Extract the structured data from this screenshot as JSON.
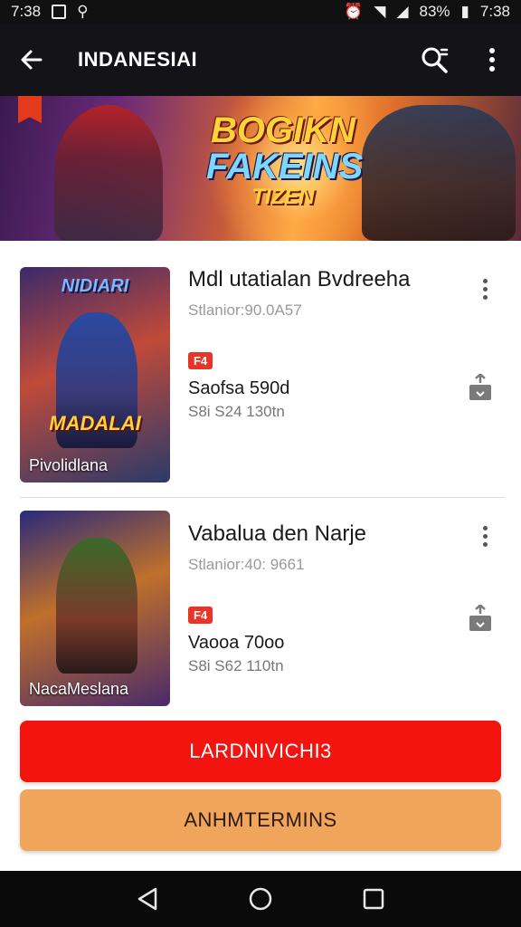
{
  "status_bar": {
    "time_left": "7:38",
    "battery": "83%",
    "time_right": "7:38"
  },
  "app_bar": {
    "title": "INDANESIAI"
  },
  "banner": {
    "logo_line1": "BOGIKN",
    "logo_line2": "FAKEINS",
    "logo_line3": "TIZEN"
  },
  "items": [
    {
      "title": "Mdl utatialan Bvdreeha",
      "subtitle": "Stlanior:90.0A57",
      "badge": "F4",
      "price": "Saofsa  590d",
      "size": "S8i S24  130tn",
      "thumb_logo": "NIDIARI",
      "thumb_logo2": "MADALAI",
      "thumb_caption": "Pivolidlana"
    },
    {
      "title": "Vabalua den Narje",
      "subtitle": "Stlanior:40: 9661",
      "badge": "F4",
      "price": "Vaooa  70oo",
      "size": "S8i S62  110tn",
      "thumb_caption": "NacaMeslana"
    }
  ],
  "buttons": {
    "primary": "LARDNIVICHI3",
    "secondary": "ANHMTERMINS"
  },
  "colors": {
    "primary_button": "#f3140f",
    "secondary_button": "#f0a55a",
    "app_bar": "#141418"
  }
}
